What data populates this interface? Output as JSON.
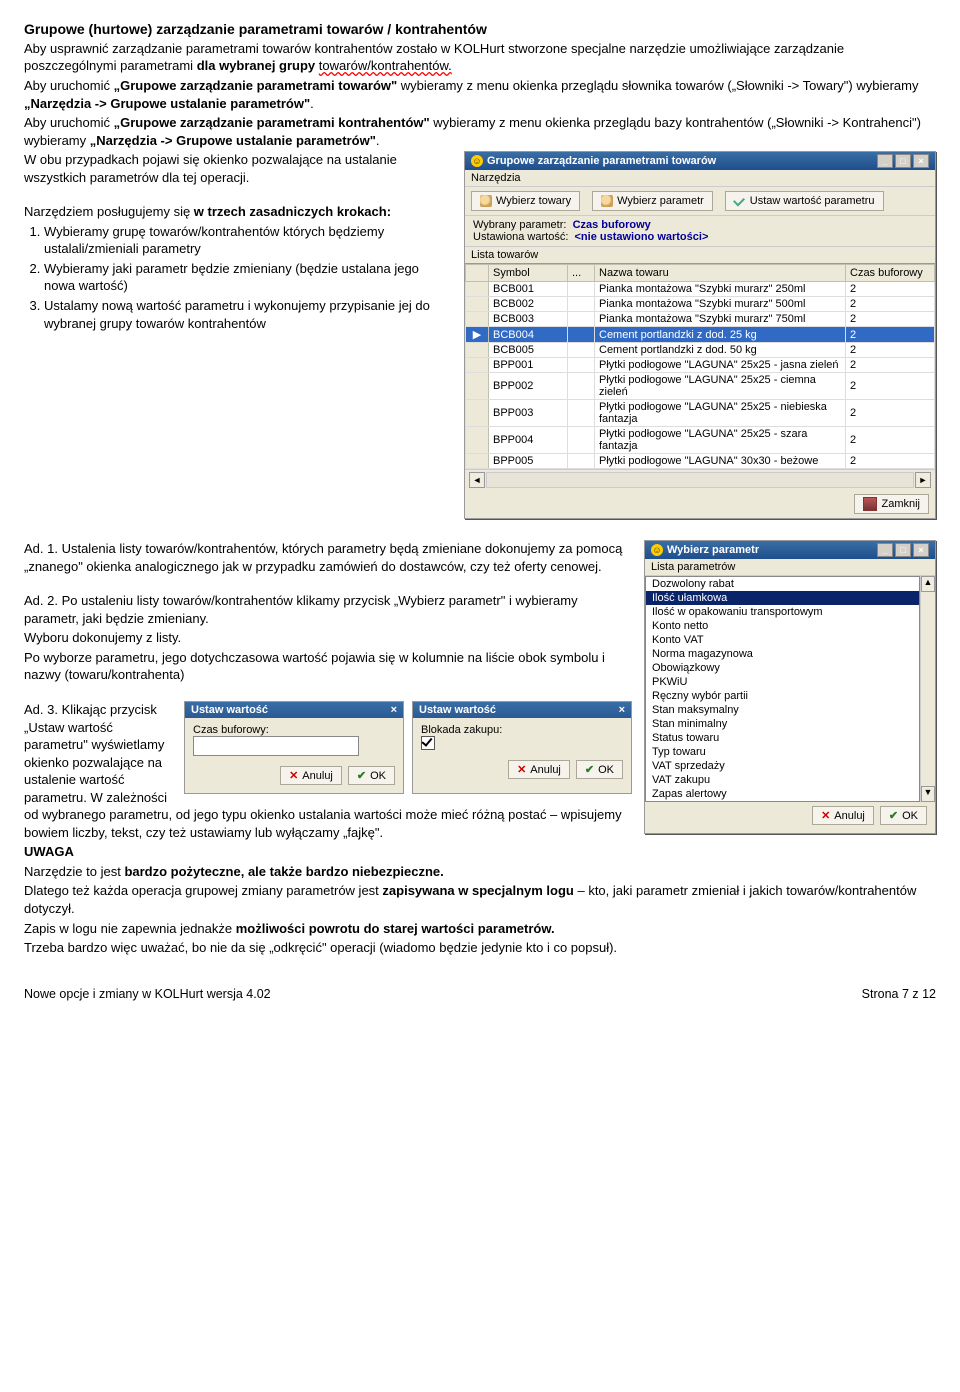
{
  "doc": {
    "title": "Grupowe (hurtowe) zarządzanie parametrami towarów / kontrahentów",
    "p1a": "Aby usprawnić zarządzanie parametrami towarów kontrahentów zostało w KOLHurt stworzone specjalne narzędzie umożliwiające zarządzanie poszczególnymi parametrami ",
    "p1b": "dla wybranej grupy",
    "p1c": " towarów/kontrahentów.",
    "p2a": "Aby uruchomić ",
    "p2b": "„Grupowe zarządzanie parametrami towarów\"",
    "p2c": " wybieramy z menu okienka przeglądu słownika towarów („Słowniki -> Towary\") wybieramy ",
    "p2d": "„Narzędzia -> Grupowe ustalanie parametrów\"",
    "p2e": ".",
    "p3a": "Aby uruchomić ",
    "p3b": "„Grupowe zarządzanie parametrami kontrahentów\"",
    "p3c": " wybieramy z menu okienka przeglądu bazy kontrahentów („Słowniki -> Kontrahenci\") wybieramy ",
    "p3d": "„Narzędzia -> Grupowe ustalanie parametrów\"",
    "p3e": ".",
    "p4": "W obu przypadkach pojawi się okienko pozwalające na ustalanie wszystkich parametrów dla tej operacji.",
    "p5a": "Narzędziem posługujemy się ",
    "p5b": "w trzech zasadniczych krokach:",
    "li1": "Wybieramy grupę towarów/kontrahentów których będziemy ustalali/zmieniali parametry",
    "li2": "Wybieramy jaki parametr będzie zmieniany (będzie ustalana jego nowa wartość)",
    "li3": "Ustalamy nową wartość parametru i wykonujemy przypisanie jej do wybranej grupy towarów kontrahentów",
    "ad1": "Ad. 1. Ustalenia listy towarów/kontrahentów, których parametry będą zmieniane dokonujemy za pomocą „znanego\" okienka analogicznego jak w przypadku zamówień do dostawców, czy też oferty cenowej.",
    "ad2": "Ad. 2. Po ustaleniu listy towarów/kontrahentów klikamy przycisk „Wybierz parametr\" i wybieramy parametr, jaki będzie zmieniany.",
    "ad2b": "Wyboru dokonujemy z listy.",
    "ad2c": "Po wyborze parametru, jego dotychczasowa wartość pojawia się w kolumnie na liście obok symbolu i nazwy (towaru/kontrahenta)",
    "ad3a": "Ad. 3. Klikając przycisk „Ustaw wartość parametru\" wyświetlamy okienko pozwalające na ustalenie wartość parametru. W zależności od wybranego parametru, od jego typu okienko ustalania wartości może mieć różną postać – wpisujemy bowiem liczby, tekst, czy też ustawiamy lub wyłączamy „fajkę\".",
    "uwaga": "UWAGA",
    "uwaga1a": "Narzędzie to jest ",
    "uwaga1b": "bardzo pożyteczne, ale także bardzo niebezpieczne.",
    "uwaga2a": "Dlatego też każda operacja grupowej zmiany parametrów jest ",
    "uwaga2b": "zapisywana w specjalnym logu",
    "uwaga2c": " – kto, jaki parametr zmieniał i jakich towarów/kontrahentów dotyczył.",
    "uwaga3a": "Zapis w logu nie zapewnia jednakże ",
    "uwaga3b": "możliwości powrotu do starej wartości parametrów.",
    "uwaga4": "Trzeba bardzo więc uważać, bo nie da się „odkręcić\" operacji (wiadomo będzie jedynie kto i co popsuł).",
    "footer_left": "Nowe opcje i zmiany w KOLHurt wersja 4.02",
    "footer_right": "Strona 7 z 12"
  },
  "win1": {
    "title": "Grupowe zarządzanie parametrami towarów",
    "menu": "Narzędzia",
    "btn1": "Wybierz towary",
    "btn2": "Wybierz parametr",
    "btn3": "Ustaw wartość parametru",
    "lbl_param": "Wybrany parametr:",
    "val_param": "Czas buforowy",
    "lbl_set": "Ustawiona wartość:",
    "val_set": "<nie ustawiono wartości>",
    "list_title": "Lista towarów",
    "col1": "Symbol",
    "col2": "Nazwa towaru",
    "col3": "Czas buforowy",
    "rows": [
      {
        "s": "BCB001",
        "n": "Pianka montażowa \"Szybki murarz\" 250ml",
        "v": "2"
      },
      {
        "s": "BCB002",
        "n": "Pianka montażowa \"Szybki murarz\" 500ml",
        "v": "2"
      },
      {
        "s": "BCB003",
        "n": "Pianka montażowa \"Szybki murarz\" 750ml",
        "v": "2"
      },
      {
        "s": "BCB004",
        "n": "Cement portlandzki z dod. 25 kg",
        "v": "2"
      },
      {
        "s": "BCB005",
        "n": "Cement portlandzki z dod. 50 kg",
        "v": "2"
      },
      {
        "s": "BPP001",
        "n": "Płytki podłogowe \"LAGUNA\" 25x25 - jasna zieleń",
        "v": "2"
      },
      {
        "s": "BPP002",
        "n": "Płytki podłogowe \"LAGUNA\" 25x25 - ciemna zieleń",
        "v": "2"
      },
      {
        "s": "BPP003",
        "n": "Płytki podłogowe \"LAGUNA\" 25x25 - niebieska fantazja",
        "v": "2"
      },
      {
        "s": "BPP004",
        "n": "Płytki podłogowe \"LAGUNA\" 25x25 - szara fantazja",
        "v": "2"
      },
      {
        "s": "BPP005",
        "n": "Płytki podłogowe \"LAGUNA\" 30x30 - beżowe",
        "v": "2"
      }
    ],
    "close": "Zamknij"
  },
  "win2": {
    "title": "Wybierz parametr",
    "menu": "Lista parametrów",
    "items": [
      "Dozwolony rabat",
      "Ilość ułamkowa",
      "Ilość w opakowaniu transportowym",
      "Konto netto",
      "Konto VAT",
      "Norma magazynowa",
      "Obowiązkowy",
      "PKWiU",
      "Ręczny wybór partii",
      "Stan maksymalny",
      "Stan minimalny",
      "Status towaru",
      "Typ towaru",
      "VAT sprzedaży",
      "VAT zakupu",
      "Zapas alertowy"
    ],
    "selected_index": 1,
    "anuluj": "Anuluj",
    "ok": "OK"
  },
  "dlg1": {
    "title": "Ustaw wartość",
    "label": "Czas buforowy:",
    "anuluj": "Anuluj",
    "ok": "OK"
  },
  "dlg2": {
    "title": "Ustaw wartość",
    "label": "Blokada zakupu:",
    "anuluj": "Anuluj",
    "ok": "OK"
  }
}
